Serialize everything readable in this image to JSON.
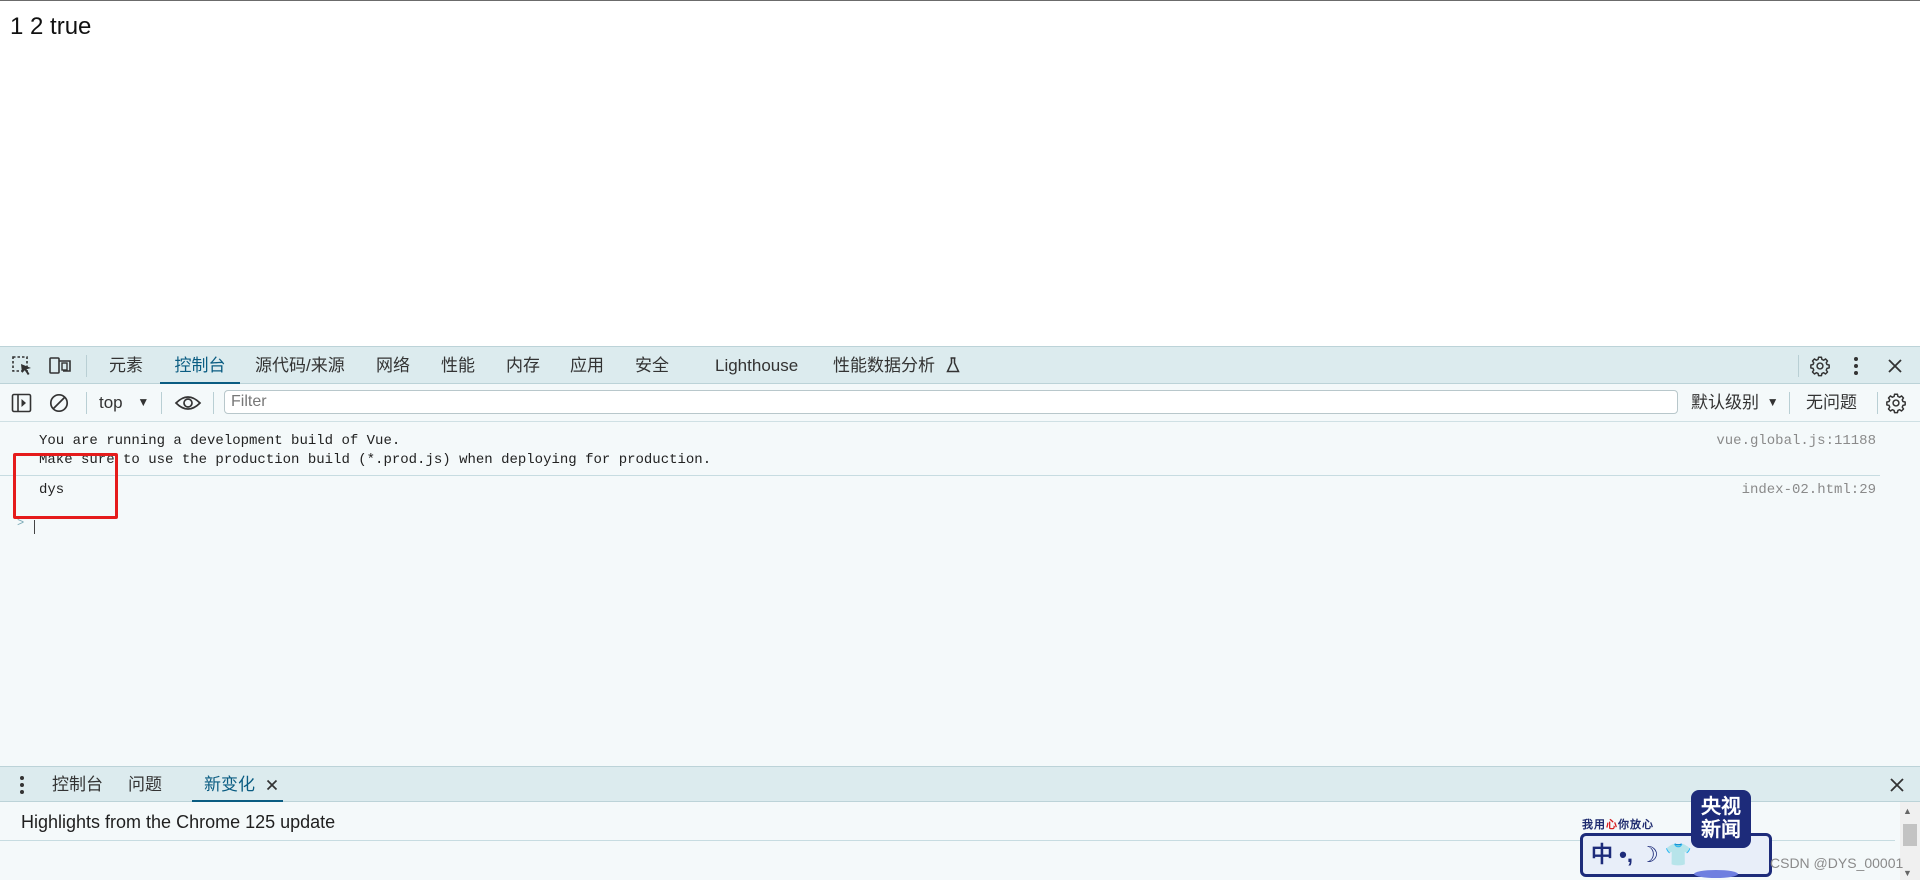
{
  "page": {
    "text": "1 2 true"
  },
  "devtools": {
    "tabs": [
      {
        "label": "元素"
      },
      {
        "label": "控制台"
      },
      {
        "label": "源代码/来源"
      },
      {
        "label": "网络"
      },
      {
        "label": "性能"
      },
      {
        "label": "内存"
      },
      {
        "label": "应用"
      },
      {
        "label": "安全"
      },
      {
        "label": "Lighthouse"
      },
      {
        "label": "性能数据分析"
      }
    ],
    "active_tab": "控制台"
  },
  "console_toolbar": {
    "context": "top",
    "filter_placeholder": "Filter",
    "levels": "默认级别",
    "issues": "无问题"
  },
  "messages": [
    {
      "lines": [
        "You are running a development build of Vue.",
        "Make sure to use the production build (*.prod.js) when deploying for production."
      ],
      "source": "vue.global.js:11188"
    },
    {
      "lines": [
        "dys"
      ],
      "source": "index-02.html:29"
    }
  ],
  "prompt": {
    "symbol": ">"
  },
  "drawer": {
    "tabs": [
      {
        "label": "控制台"
      },
      {
        "label": "问题"
      },
      {
        "label": "新变化"
      }
    ],
    "active_tab": "新变化",
    "highlights": "Highlights from the Chrome 125 update"
  },
  "watermark": {
    "logo_line1": "央视",
    "logo_line2": "新闻",
    "slogan_a": "我用",
    "slogan_heart": "心",
    "slogan_b": "你放心",
    "card_text": "中 •, ☽ 👕"
  },
  "credit": "CSDN @DYS_00001",
  "colors": {
    "accent": "#0a5c82",
    "tabbar_bg": "#dcebee",
    "console_bg": "#f4f9fa",
    "highlight_box": "#e51b1b"
  }
}
